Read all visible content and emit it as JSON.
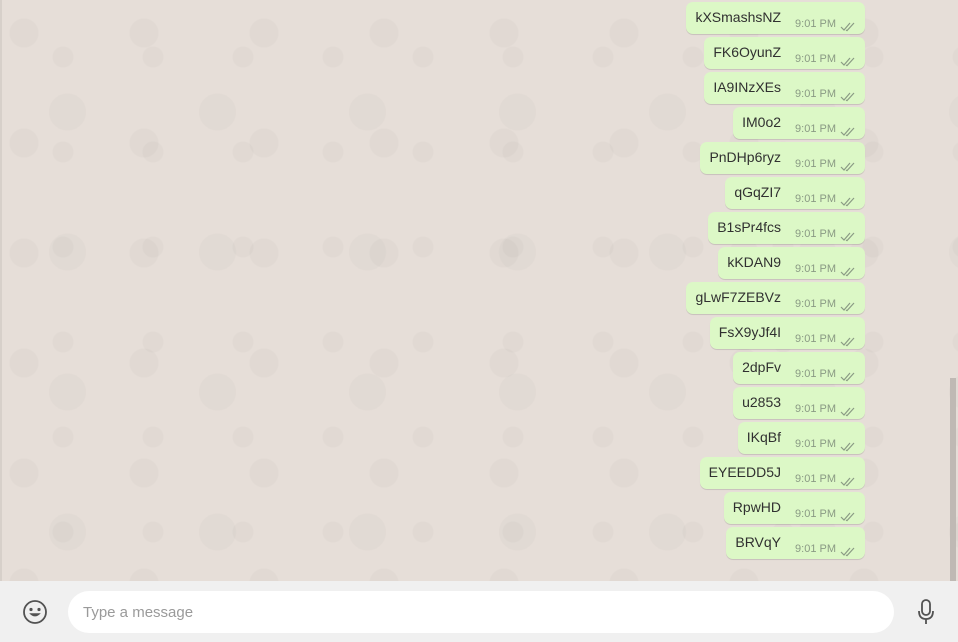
{
  "chat": {
    "messages": [
      {
        "text": "kXSmashsNZ",
        "time": "9:01 PM",
        "status": "read"
      },
      {
        "text": "FK6OyunZ",
        "time": "9:01 PM",
        "status": "read"
      },
      {
        "text": "IA9INzXEs",
        "time": "9:01 PM",
        "status": "read"
      },
      {
        "text": "IM0o2",
        "time": "9:01 PM",
        "status": "read"
      },
      {
        "text": "PnDHp6ryz",
        "time": "9:01 PM",
        "status": "read"
      },
      {
        "text": "qGqZI7",
        "time": "9:01 PM",
        "status": "read"
      },
      {
        "text": "B1sPr4fcs",
        "time": "9:01 PM",
        "status": "read"
      },
      {
        "text": "kKDAN9",
        "time": "9:01 PM",
        "status": "read"
      },
      {
        "text": "gLwF7ZEBVz",
        "time": "9:01 PM",
        "status": "read"
      },
      {
        "text": "FsX9yJf4I",
        "time": "9:01 PM",
        "status": "read"
      },
      {
        "text": "2dpFv",
        "time": "9:01 PM",
        "status": "read"
      },
      {
        "text": "u2853",
        "time": "9:01 PM",
        "status": "read"
      },
      {
        "text": "IKqBf",
        "time": "9:01 PM",
        "status": "read"
      },
      {
        "text": "EYEEDD5J",
        "time": "9:01 PM",
        "status": "read"
      },
      {
        "text": "RpwHD",
        "time": "9:01 PM",
        "status": "read"
      },
      {
        "text": "BRVqY",
        "time": "9:01 PM",
        "status": "read"
      }
    ]
  },
  "composer": {
    "placeholder": "Type a message",
    "value": "",
    "emoji_icon": "smiley-icon",
    "mic_icon": "microphone-icon"
  },
  "colors": {
    "outgoing_bubble": "#dcf8c6",
    "chat_background": "#e6ded8",
    "footer_background": "#f0f0f0",
    "tick_color": "#8a9a84"
  }
}
